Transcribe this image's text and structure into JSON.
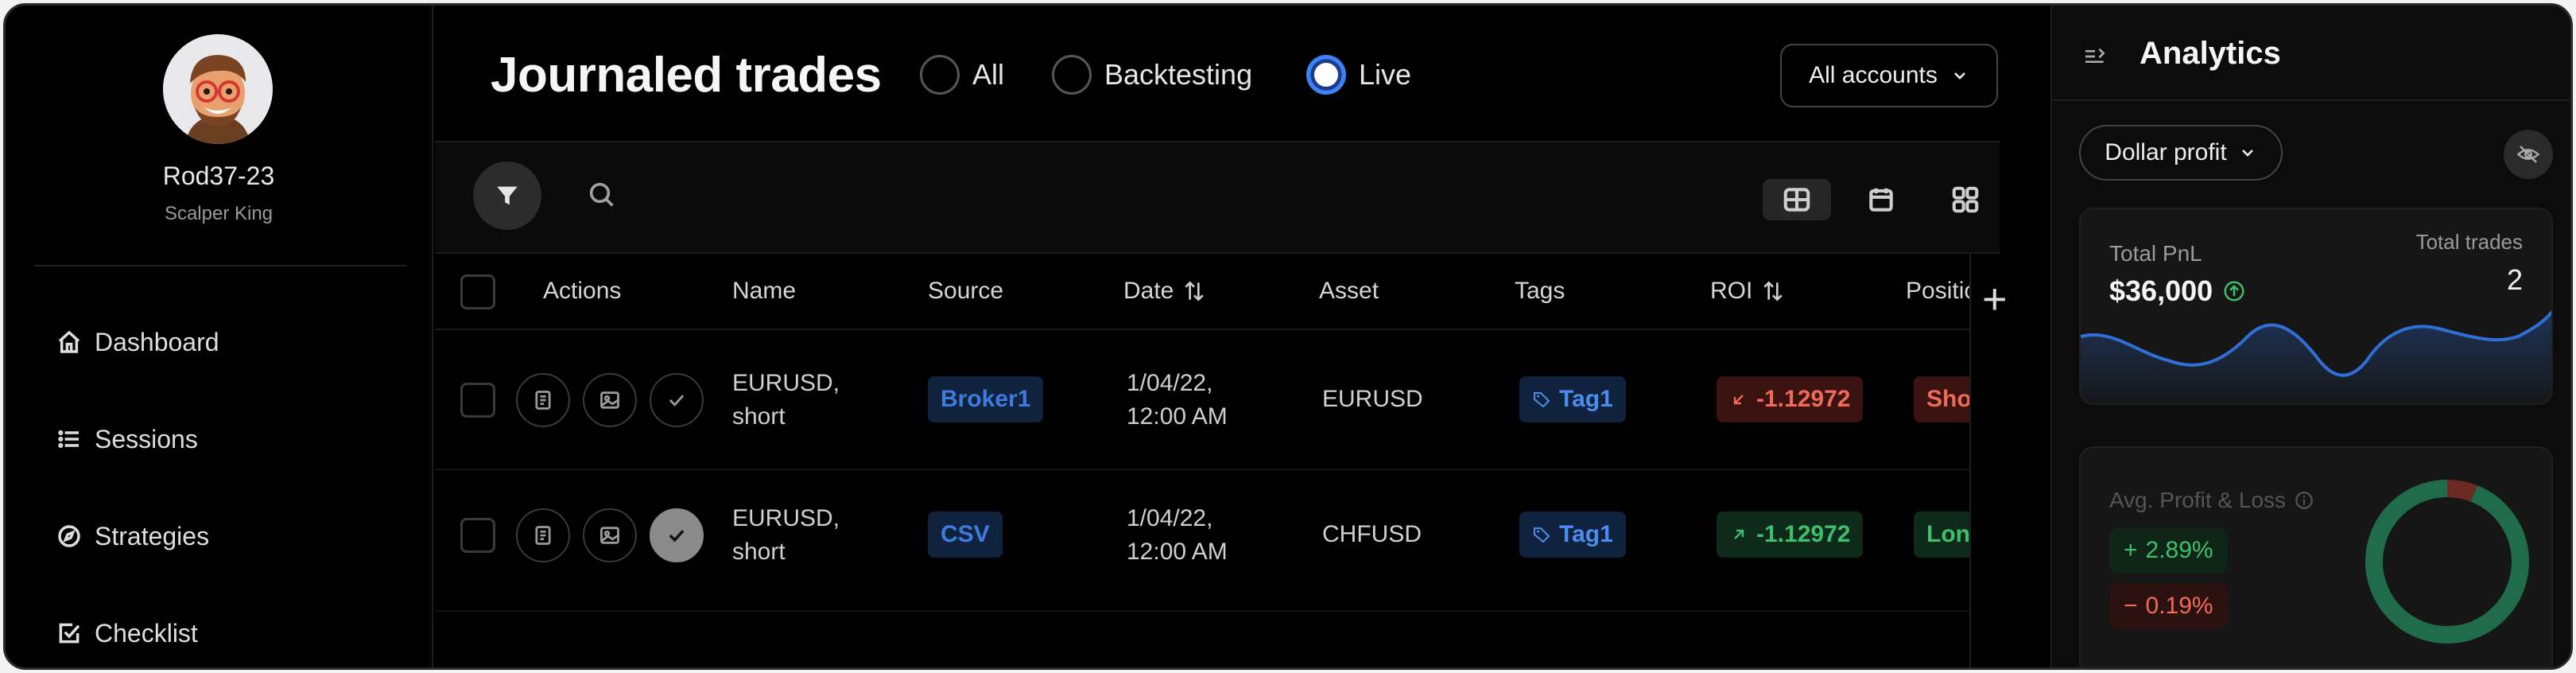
{
  "user": {
    "name": "Rod37-23",
    "title": "Scalper King"
  },
  "sidebar": {
    "items": [
      {
        "label": "Dashboard",
        "icon": "home-icon"
      },
      {
        "label": "Sessions",
        "icon": "list-icon"
      },
      {
        "label": "Strategies",
        "icon": "compass-icon"
      },
      {
        "label": "Checklist",
        "icon": "checkbox-icon"
      }
    ]
  },
  "header": {
    "title": "Journaled trades",
    "filters": [
      {
        "label": "All",
        "selected": false
      },
      {
        "label": "Backtesting",
        "selected": false
      },
      {
        "label": "Live",
        "selected": true
      }
    ],
    "accounts_label": "All accounts"
  },
  "table": {
    "columns": [
      "Actions",
      "Name",
      "Source",
      "Date",
      "Asset",
      "Tags",
      "ROI",
      "Position"
    ],
    "rows": [
      {
        "name_line1": "EURUSD,",
        "name_line2": "short",
        "source": "Broker1",
        "date_line1": "1/04/22,",
        "date_line2": "12:00 AM",
        "asset": "EURUSD",
        "tag": "Tag1",
        "roi": "-1.12972",
        "roi_direction": "down",
        "position": "Short",
        "checked": false
      },
      {
        "name_line1": "EURUSD,",
        "name_line2": "short",
        "source": "CSV",
        "date_line1": "1/04/22,",
        "date_line2": "12:00 AM",
        "asset": "CHFUSD",
        "tag": "Tag1",
        "roi": "-1.12972",
        "roi_direction": "up",
        "position": "Long",
        "checked": true
      }
    ]
  },
  "analytics": {
    "title": "Analytics",
    "metric_select": "Dollar profit",
    "total_pnl_label": "Total PnL",
    "total_pnl_value": "$36,000",
    "total_trades_label": "Total trades",
    "total_trades_value": "2",
    "avg_pl_label": "Avg. Profit & Loss",
    "avg_profit": "2.89%",
    "avg_loss": "0.19%",
    "donut_profit_share": 0.94,
    "colors": {
      "profit": "#1f6b4a",
      "loss": "#6b2a22",
      "line": "#2f6fd6"
    }
  },
  "colors": {
    "accent": "#3b82f6",
    "background": "#000000"
  }
}
